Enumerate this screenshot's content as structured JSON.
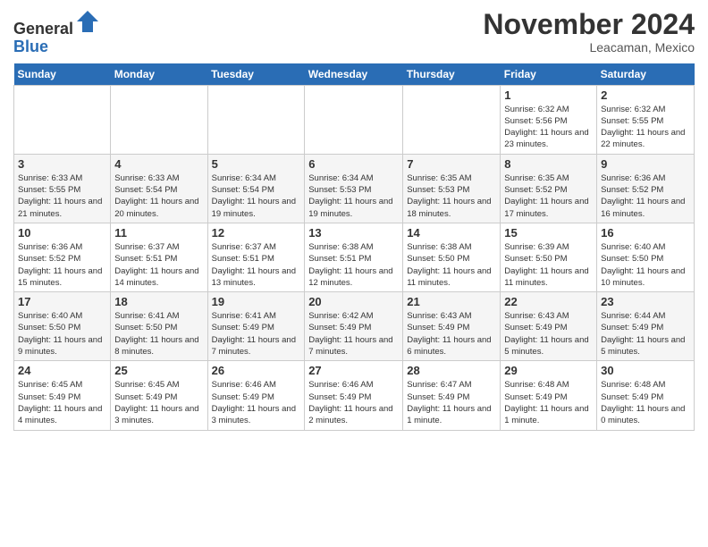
{
  "header": {
    "logo_general": "General",
    "logo_blue": "Blue",
    "month_title": "November 2024",
    "location": "Leacaman, Mexico"
  },
  "weekdays": [
    "Sunday",
    "Monday",
    "Tuesday",
    "Wednesday",
    "Thursday",
    "Friday",
    "Saturday"
  ],
  "weeks": [
    [
      {
        "day": "",
        "info": ""
      },
      {
        "day": "",
        "info": ""
      },
      {
        "day": "",
        "info": ""
      },
      {
        "day": "",
        "info": ""
      },
      {
        "day": "",
        "info": ""
      },
      {
        "day": "1",
        "info": "Sunrise: 6:32 AM\nSunset: 5:56 PM\nDaylight: 11 hours and 23 minutes."
      },
      {
        "day": "2",
        "info": "Sunrise: 6:32 AM\nSunset: 5:55 PM\nDaylight: 11 hours and 22 minutes."
      }
    ],
    [
      {
        "day": "3",
        "info": "Sunrise: 6:33 AM\nSunset: 5:55 PM\nDaylight: 11 hours and 21 minutes."
      },
      {
        "day": "4",
        "info": "Sunrise: 6:33 AM\nSunset: 5:54 PM\nDaylight: 11 hours and 20 minutes."
      },
      {
        "day": "5",
        "info": "Sunrise: 6:34 AM\nSunset: 5:54 PM\nDaylight: 11 hours and 19 minutes."
      },
      {
        "day": "6",
        "info": "Sunrise: 6:34 AM\nSunset: 5:53 PM\nDaylight: 11 hours and 19 minutes."
      },
      {
        "day": "7",
        "info": "Sunrise: 6:35 AM\nSunset: 5:53 PM\nDaylight: 11 hours and 18 minutes."
      },
      {
        "day": "8",
        "info": "Sunrise: 6:35 AM\nSunset: 5:52 PM\nDaylight: 11 hours and 17 minutes."
      },
      {
        "day": "9",
        "info": "Sunrise: 6:36 AM\nSunset: 5:52 PM\nDaylight: 11 hours and 16 minutes."
      }
    ],
    [
      {
        "day": "10",
        "info": "Sunrise: 6:36 AM\nSunset: 5:52 PM\nDaylight: 11 hours and 15 minutes."
      },
      {
        "day": "11",
        "info": "Sunrise: 6:37 AM\nSunset: 5:51 PM\nDaylight: 11 hours and 14 minutes."
      },
      {
        "day": "12",
        "info": "Sunrise: 6:37 AM\nSunset: 5:51 PM\nDaylight: 11 hours and 13 minutes."
      },
      {
        "day": "13",
        "info": "Sunrise: 6:38 AM\nSunset: 5:51 PM\nDaylight: 11 hours and 12 minutes."
      },
      {
        "day": "14",
        "info": "Sunrise: 6:38 AM\nSunset: 5:50 PM\nDaylight: 11 hours and 11 minutes."
      },
      {
        "day": "15",
        "info": "Sunrise: 6:39 AM\nSunset: 5:50 PM\nDaylight: 11 hours and 11 minutes."
      },
      {
        "day": "16",
        "info": "Sunrise: 6:40 AM\nSunset: 5:50 PM\nDaylight: 11 hours and 10 minutes."
      }
    ],
    [
      {
        "day": "17",
        "info": "Sunrise: 6:40 AM\nSunset: 5:50 PM\nDaylight: 11 hours and 9 minutes."
      },
      {
        "day": "18",
        "info": "Sunrise: 6:41 AM\nSunset: 5:50 PM\nDaylight: 11 hours and 8 minutes."
      },
      {
        "day": "19",
        "info": "Sunrise: 6:41 AM\nSunset: 5:49 PM\nDaylight: 11 hours and 7 minutes."
      },
      {
        "day": "20",
        "info": "Sunrise: 6:42 AM\nSunset: 5:49 PM\nDaylight: 11 hours and 7 minutes."
      },
      {
        "day": "21",
        "info": "Sunrise: 6:43 AM\nSunset: 5:49 PM\nDaylight: 11 hours and 6 minutes."
      },
      {
        "day": "22",
        "info": "Sunrise: 6:43 AM\nSunset: 5:49 PM\nDaylight: 11 hours and 5 minutes."
      },
      {
        "day": "23",
        "info": "Sunrise: 6:44 AM\nSunset: 5:49 PM\nDaylight: 11 hours and 5 minutes."
      }
    ],
    [
      {
        "day": "24",
        "info": "Sunrise: 6:45 AM\nSunset: 5:49 PM\nDaylight: 11 hours and 4 minutes."
      },
      {
        "day": "25",
        "info": "Sunrise: 6:45 AM\nSunset: 5:49 PM\nDaylight: 11 hours and 3 minutes."
      },
      {
        "day": "26",
        "info": "Sunrise: 6:46 AM\nSunset: 5:49 PM\nDaylight: 11 hours and 3 minutes."
      },
      {
        "day": "27",
        "info": "Sunrise: 6:46 AM\nSunset: 5:49 PM\nDaylight: 11 hours and 2 minutes."
      },
      {
        "day": "28",
        "info": "Sunrise: 6:47 AM\nSunset: 5:49 PM\nDaylight: 11 hours and 1 minute."
      },
      {
        "day": "29",
        "info": "Sunrise: 6:48 AM\nSunset: 5:49 PM\nDaylight: 11 hours and 1 minute."
      },
      {
        "day": "30",
        "info": "Sunrise: 6:48 AM\nSunset: 5:49 PM\nDaylight: 11 hours and 0 minutes."
      }
    ]
  ]
}
